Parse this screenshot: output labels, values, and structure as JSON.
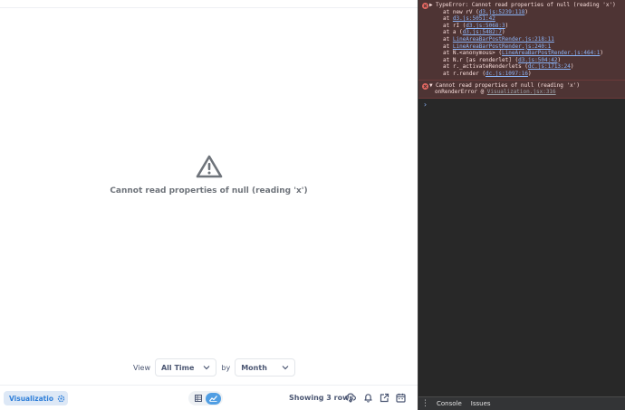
{
  "main": {
    "error_message": "Cannot read properties of null (reading 'x')"
  },
  "controls": {
    "view_label": "View",
    "view_value": "All Time",
    "by_label": "by",
    "by_value": "Month"
  },
  "footer": {
    "visualization_label": "Visualization",
    "row_count": "Showing 3 rows"
  },
  "devtools": {
    "error1": {
      "header": "TypeError: Cannot read properties of null (reading 'x')",
      "stack": [
        {
          "prefix": "at new rV (",
          "link": "d3.js:5239:118",
          "suffix": ")"
        },
        {
          "prefix": "at ",
          "link": "d3.js:5051:42",
          "suffix": ""
        },
        {
          "prefix": "at rI (",
          "link": "d3.js:5068:3",
          "suffix": ")"
        },
        {
          "prefix": "at a (",
          "link": "d3.js:5482:7",
          "suffix": ")"
        },
        {
          "prefix": "at ",
          "link": "LineAreaBarPostRender.js:218:11",
          "suffix": ""
        },
        {
          "prefix": "at ",
          "link": "LineAreaBarPostRender.js:240:1",
          "suffix": ""
        },
        {
          "prefix": "at N.<anonymous> (",
          "link": "LineAreaBarPostRender.js:464:1",
          "suffix": ")"
        },
        {
          "prefix": "at N.r [as renderlet] (",
          "link": "d3.js:504:42",
          "suffix": ")"
        },
        {
          "prefix": "at r._activateRenderlets (",
          "link": "dc.js:1713:24",
          "suffix": ")"
        },
        {
          "prefix": "at r.render (",
          "link": "dc.js:1097:16",
          "suffix": ")"
        }
      ]
    },
    "error2": {
      "header": "Cannot read properties of null (reading 'x')",
      "prefix": "onRenderError @ ",
      "link": "Visualization.jsx:316"
    },
    "tabs": [
      "Console",
      "Issues"
    ]
  }
}
